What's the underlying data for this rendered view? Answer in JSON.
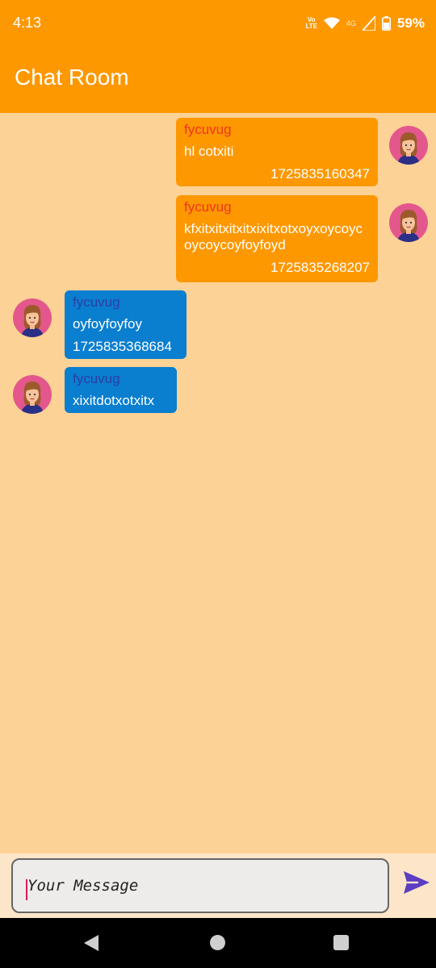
{
  "status_bar": {
    "time": "4:13",
    "volte_top": "Vo",
    "volte_bottom": "LTE",
    "network": "4G",
    "battery": "59%",
    "icons": [
      "volte-icon",
      "wifi-icon",
      "signal-icon",
      "battery-icon"
    ]
  },
  "app_bar": {
    "title": "Chat Room"
  },
  "messages": [
    {
      "direction": "outgoing",
      "sender": "fycuvug",
      "text": "hl cotxiti",
      "timestamp": "1725835160347"
    },
    {
      "direction": "outgoing",
      "sender": "fycuvug",
      "text": "kfxitxitxitxitxixitxotxoyxoycoycoycoycoyfoyfoyd",
      "timestamp": "1725835268207"
    },
    {
      "direction": "incoming",
      "sender": "fycuvug",
      "text": "oyfoyfoyfoy",
      "timestamp": "1725835368684"
    },
    {
      "direction": "incoming",
      "sender": "fycuvug",
      "text": "xixitdotxotxitx",
      "timestamp": ""
    }
  ],
  "input": {
    "placeholder": "Your Message",
    "value": ""
  },
  "colors": {
    "app_bar": "#fe9800",
    "background": "#fdd296",
    "outgoing_bubble": "#fe9800",
    "incoming_bubble": "#0a7ecf",
    "send_icon": "#5b3ec2"
  },
  "nav_bar": {
    "icons": [
      "back-icon",
      "home-icon",
      "recents-icon"
    ]
  }
}
